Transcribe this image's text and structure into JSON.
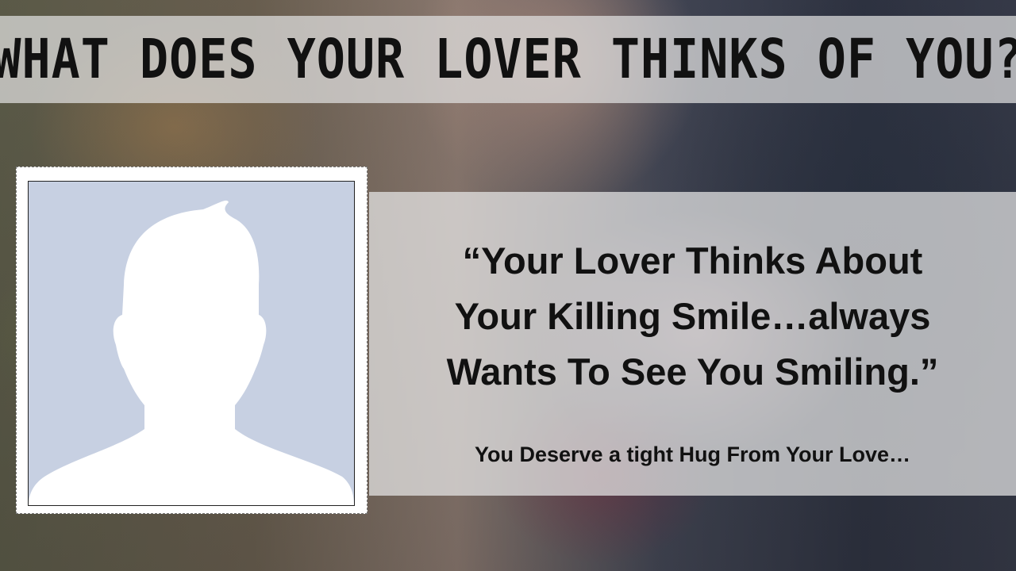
{
  "header": {
    "title": "WHAT DOES YOUR LOVER THINKS OF YOU?"
  },
  "profile": {
    "icon": "default-profile-silhouette",
    "placeholder_bg": "#c7d0e2"
  },
  "quote": {
    "lines": [
      "“Your Lover Thinks About",
      "Your Killing Smile…always",
      "Wants To See You Smiling.”"
    ],
    "subtext": "You Deserve a tight Hug From Your Love…"
  }
}
